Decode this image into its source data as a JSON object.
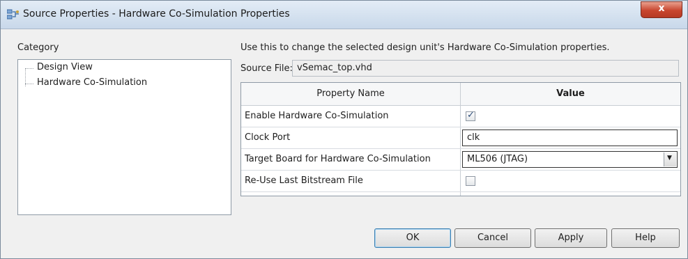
{
  "window": {
    "title": "Source Properties - Hardware Co-Simulation Properties",
    "close_label": "x"
  },
  "category": {
    "label": "Category",
    "items": [
      {
        "label": "Design View"
      },
      {
        "label": "Hardware Co-Simulation"
      }
    ]
  },
  "main": {
    "description": "Use this to change the selected design unit's Hardware Co-Simulation properties.",
    "source_file_label": "Source File:",
    "source_file_value": "vSemac_top.vhd"
  },
  "grid": {
    "headers": [
      "Property Name",
      "Value"
    ],
    "rows": [
      {
        "name": "Enable Hardware Co-Simulation",
        "type": "checkbox",
        "checked": true
      },
      {
        "name": "Clock Port",
        "type": "text",
        "value": "clk"
      },
      {
        "name": "Target Board for Hardware Co-Simulation",
        "type": "select",
        "value": "ML506 (JTAG)"
      },
      {
        "name": "Re-Use Last Bitstream File",
        "type": "checkbox",
        "checked": false
      }
    ]
  },
  "buttons": {
    "ok": "OK",
    "cancel": "Cancel",
    "apply": "Apply",
    "help": "Help"
  }
}
